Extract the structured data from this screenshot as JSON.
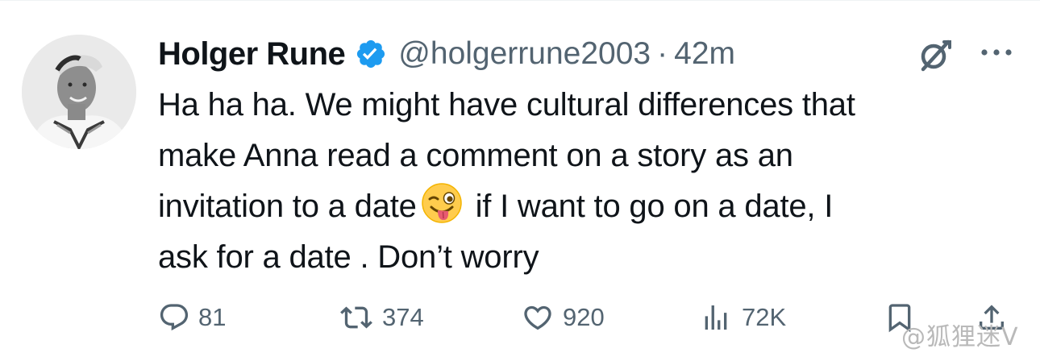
{
  "author": {
    "name": "Holger Rune",
    "handle": "@holgerrune2003",
    "separator": "·",
    "time": "42m",
    "verified": true
  },
  "tweet": {
    "lines": [
      "Ha ha ha. We might have cultural differences that",
      "make Anna read a comment on a story as an",
      "invitation to a date",
      " if I want to go on a date, I",
      "ask for a date . Don’t worry"
    ],
    "emoji": "winking-face-with-tongue"
  },
  "actions": {
    "replies": "81",
    "retweets": "374",
    "likes": "920",
    "views": "72K"
  },
  "icons": {
    "verified": "verified-badge-icon",
    "grok": "grok-icon",
    "more": "more-icon",
    "reply": "reply-icon",
    "retweet": "retweet-icon",
    "like": "heart-icon",
    "views": "views-icon",
    "bookmark": "bookmark-icon",
    "share": "share-icon"
  },
  "colors": {
    "text": "#0f1419",
    "secondary": "#536471",
    "verified": "#1d9bf0"
  },
  "watermark": "@狐狸迷V"
}
